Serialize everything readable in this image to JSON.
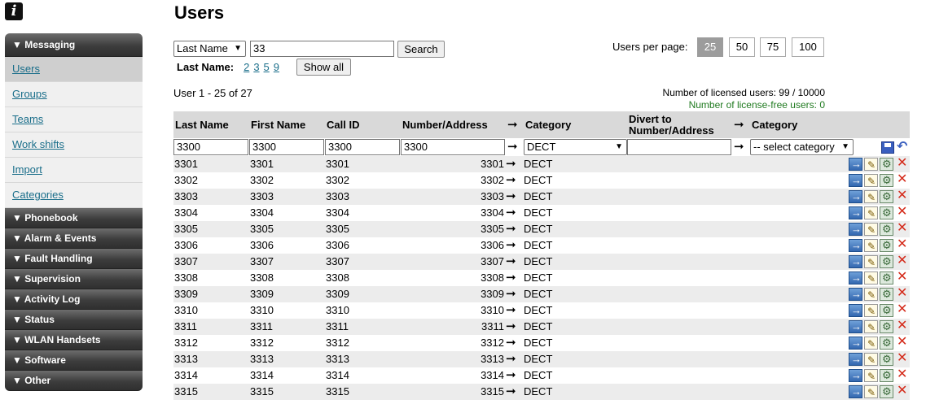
{
  "logo": {
    "glyph": "i"
  },
  "sidebar": {
    "messaging_label": "▼ Messaging",
    "items": [
      {
        "label": "Users",
        "active": true
      },
      {
        "label": "Groups"
      },
      {
        "label": "Teams"
      },
      {
        "label": "Work shifts"
      },
      {
        "label": "Import"
      },
      {
        "label": "Categories"
      }
    ],
    "sections": [
      "▼ Phonebook",
      "▼ Alarm & Events",
      "▼ Fault Handling",
      "▼ Supervision",
      "▼ Activity Log",
      "▼ Status",
      "▼ WLAN Handsets",
      "▼ Software",
      "▼ Other"
    ]
  },
  "page": {
    "title": "Users"
  },
  "search": {
    "field_select": "Last Name",
    "query": "33",
    "search_label": "Search",
    "alpha_label": "Last Name:",
    "alpha_links": [
      "2",
      "3",
      "5",
      "9"
    ],
    "show_all_label": "Show all"
  },
  "paging": {
    "label": "Users per page:",
    "options": [
      "25",
      "50",
      "75",
      "100"
    ],
    "selected": "25",
    "range_text": "User 1 - 25 of 27"
  },
  "licenses": {
    "licensed": "Number of licensed users: 99 / 10000",
    "free": "Number of license-free users: 0",
    "free_color": "#1f7a1f"
  },
  "table": {
    "headers": {
      "last_name": "Last Name",
      "first_name": "First Name",
      "call_id": "Call ID",
      "number": "Number/Address",
      "arrow": "➞",
      "category": "Category",
      "divert_line1": "Divert to",
      "divert_line2": "Number/Address",
      "category2": "Category"
    },
    "filter": {
      "last_name": "3300",
      "first_name": "3300",
      "call_id": "3300",
      "number": "3300",
      "category": "DECT",
      "divert": "",
      "category2": "-- select category"
    },
    "rows": [
      {
        "last": "3301",
        "first": "3301",
        "call_id": "3301",
        "number": "3301",
        "category": "DECT"
      },
      {
        "last": "3302",
        "first": "3302",
        "call_id": "3302",
        "number": "3302",
        "category": "DECT"
      },
      {
        "last": "3303",
        "first": "3303",
        "call_id": "3303",
        "number": "3303",
        "category": "DECT"
      },
      {
        "last": "3304",
        "first": "3304",
        "call_id": "3304",
        "number": "3304",
        "category": "DECT"
      },
      {
        "last": "3305",
        "first": "3305",
        "call_id": "3305",
        "number": "3305",
        "category": "DECT"
      },
      {
        "last": "3306",
        "first": "3306",
        "call_id": "3306",
        "number": "3306",
        "category": "DECT"
      },
      {
        "last": "3307",
        "first": "3307",
        "call_id": "3307",
        "number": "3307",
        "category": "DECT"
      },
      {
        "last": "3308",
        "first": "3308",
        "call_id": "3308",
        "number": "3308",
        "category": "DECT"
      },
      {
        "last": "3309",
        "first": "3309",
        "call_id": "3309",
        "number": "3309",
        "category": "DECT"
      },
      {
        "last": "3310",
        "first": "3310",
        "call_id": "3310",
        "number": "3310",
        "category": "DECT"
      },
      {
        "last": "3311",
        "first": "3311",
        "call_id": "3311",
        "number": "3311",
        "category": "DECT"
      },
      {
        "last": "3312",
        "first": "3312",
        "call_id": "3312",
        "number": "3312",
        "category": "DECT"
      },
      {
        "last": "3313",
        "first": "3313",
        "call_id": "3313",
        "number": "3313",
        "category": "DECT"
      },
      {
        "last": "3314",
        "first": "3314",
        "call_id": "3314",
        "number": "3314",
        "category": "DECT"
      },
      {
        "last": "3315",
        "first": "3315",
        "call_id": "3315",
        "number": "3315",
        "category": "DECT"
      }
    ]
  }
}
